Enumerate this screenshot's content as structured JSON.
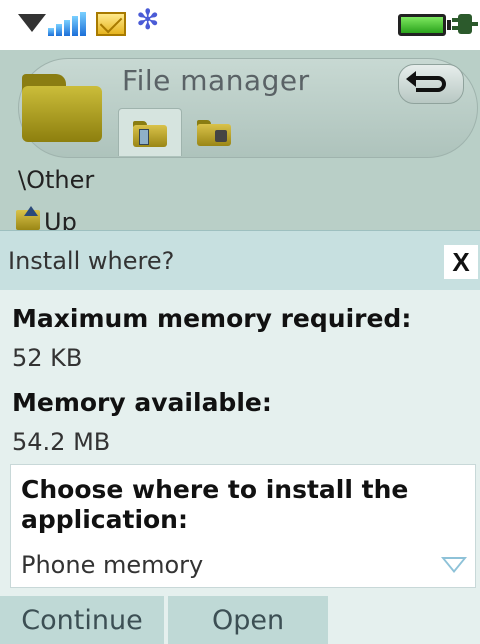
{
  "status_bar": {
    "icons": [
      "network-triangle-icon",
      "signal-strength-icon",
      "new-message-icon",
      "bluetooth-icon",
      "battery-icon",
      "charger-icon"
    ],
    "bluetooth_glyph": "✻"
  },
  "header": {
    "title": "File manager",
    "path": "\\Other",
    "up_label": "Up"
  },
  "dialog": {
    "title": "Install where?",
    "close_label": "X",
    "max_memory_label": "Maximum memory required:",
    "max_memory_value": "52 KB",
    "available_label": "Memory available:",
    "available_value": "54.2 MB",
    "choose_label": "Choose where to install the application:",
    "choose_value": "Phone memory"
  },
  "softkeys": {
    "left": "Continue",
    "center": "Open"
  },
  "colors": {
    "header_bg": "#b9cfc7",
    "dialog_bg": "#e5f0ee",
    "titlebar_bg": "#c7e0e0",
    "softkey_bg": "#bfd9d6"
  }
}
